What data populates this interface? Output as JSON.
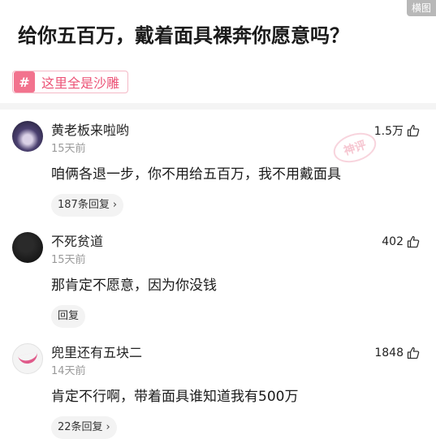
{
  "corner_label": "横图",
  "post": {
    "title": "给你五百万，戴着面具裸奔你愿意吗？",
    "topic": {
      "hash": "#",
      "label": "这里全是沙雕"
    }
  },
  "watermark_stamp": "神评",
  "comments": [
    {
      "username": "黄老板来啦哟",
      "time": "15天前",
      "content": "咱俩各退一步，你不用给五百万，我不用戴面具",
      "likes": "1.5万",
      "reply_label": "187条回复",
      "reply_has_chevron": true
    },
    {
      "username": "不死贫道",
      "time": "15天前",
      "content": "那肯定不愿意，因为你没钱",
      "likes": "402",
      "reply_label": "回复",
      "reply_has_chevron": false
    },
    {
      "username": "兜里还有五块二",
      "time": "14天前",
      "content": "肯定不行啊，带着面具谁知道我有500万",
      "likes": "1848",
      "reply_label": "22条回复",
      "reply_has_chevron": true
    }
  ],
  "colors": {
    "accent": "#f2738e",
    "topic_text": "#ec5477"
  }
}
